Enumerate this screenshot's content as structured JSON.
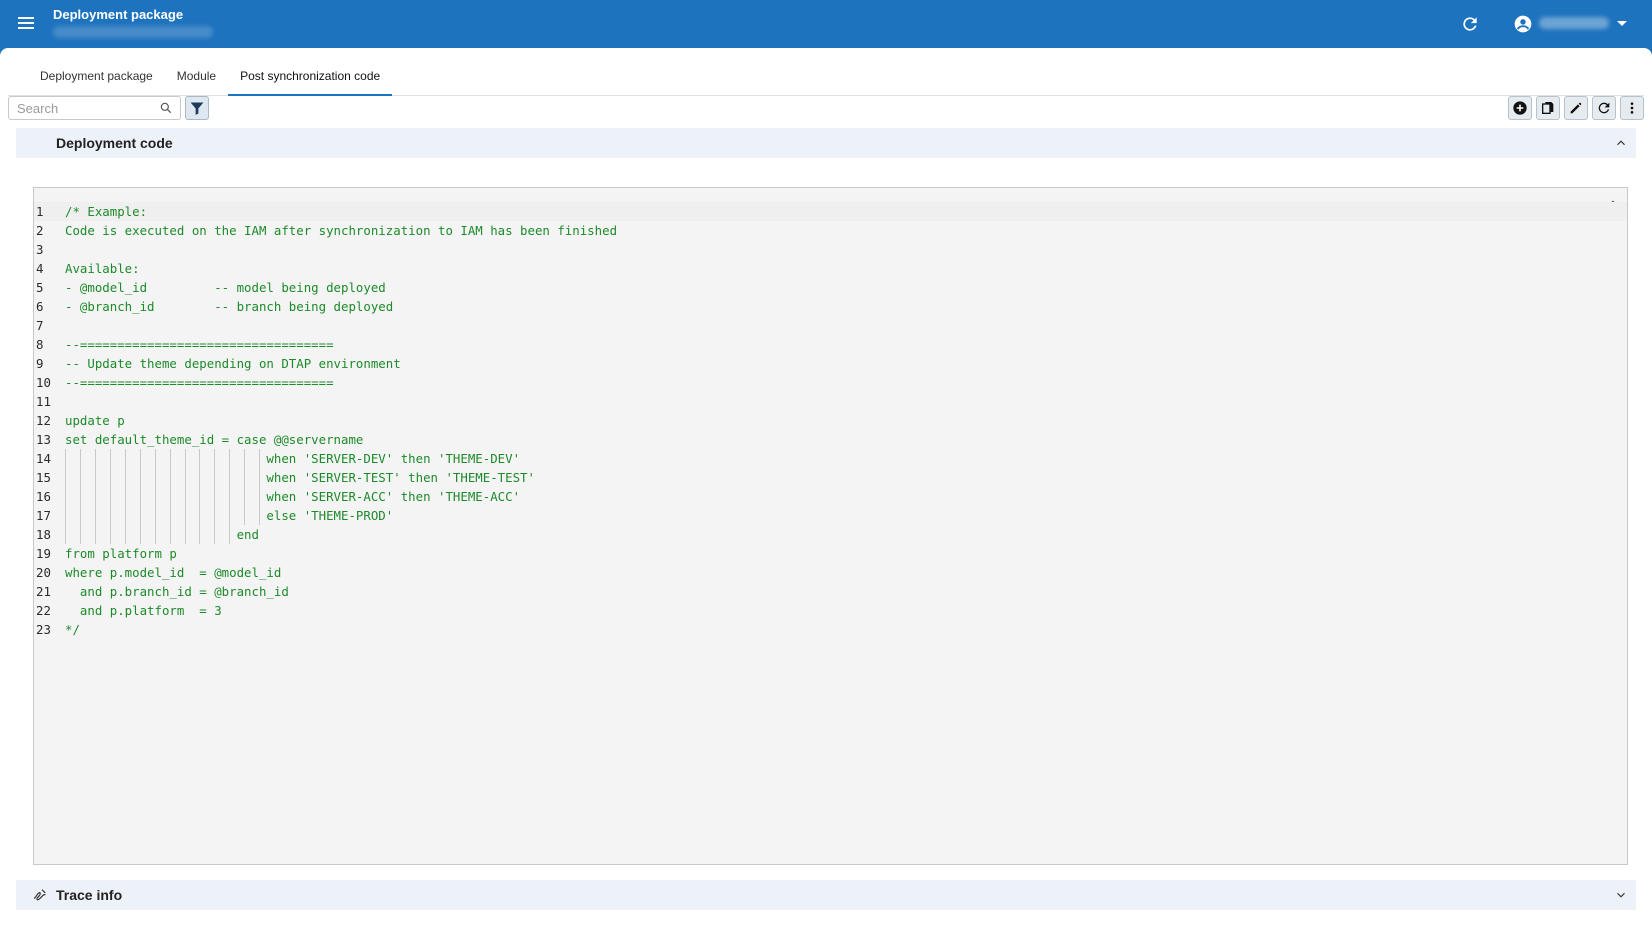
{
  "header": {
    "title": "Deployment package",
    "icons": [
      "menu-icon",
      "refresh-icon",
      "account-icon",
      "chevron-down-icon"
    ]
  },
  "tabs": [
    {
      "label": "Deployment package"
    },
    {
      "label": "Module"
    },
    {
      "label": "Post synchronization code"
    }
  ],
  "toolbar": {
    "search_placeholder": "Search",
    "right_icons": [
      "add-icon",
      "copy-icon",
      "edit-icon",
      "refresh-icon",
      "more-vert-icon"
    ]
  },
  "sections": {
    "deployment_code": {
      "title": "Deployment code"
    },
    "trace_info": {
      "title": "Trace info"
    }
  },
  "code_lines": [
    {
      "n": "1",
      "text": "/* Example:"
    },
    {
      "n": "2",
      "text": "Code is executed on the IAM after synchronization to IAM has been finished"
    },
    {
      "n": "3",
      "text": ""
    },
    {
      "n": "4",
      "text": "Available:"
    },
    {
      "n": "5",
      "text": "- @model_id         -- model being deployed"
    },
    {
      "n": "6",
      "text": "- @branch_id        -- branch being deployed"
    },
    {
      "n": "7",
      "text": ""
    },
    {
      "n": "8",
      "text": "--=================================="
    },
    {
      "n": "9",
      "text": "-- Update theme depending on DTAP environment"
    },
    {
      "n": "10",
      "text": "--=================================="
    },
    {
      "n": "11",
      "text": ""
    },
    {
      "n": "12",
      "text": "update p"
    },
    {
      "n": "13",
      "text": "set default_theme_id = case @@servername"
    },
    {
      "n": "14",
      "text": "                           when 'SERVER-DEV' then 'THEME-DEV'"
    },
    {
      "n": "15",
      "text": "                           when 'SERVER-TEST' then 'THEME-TEST'"
    },
    {
      "n": "16",
      "text": "                           when 'SERVER-ACC' then 'THEME-ACC'"
    },
    {
      "n": "17",
      "text": "                           else 'THEME-PROD'"
    },
    {
      "n": "18",
      "text": "                       end"
    },
    {
      "n": "19",
      "text": "from platform p"
    },
    {
      "n": "20",
      "text": "where p.model_id  = @model_id"
    },
    {
      "n": "21",
      "text": "  and p.branch_id = @branch_id"
    },
    {
      "n": "22",
      "text": "  and p.platform  = 3"
    },
    {
      "n": "23",
      "text": "*/"
    }
  ],
  "colors": {
    "primary": "#1e73be",
    "code_text": "#1d8a2a",
    "section_bg": "#edf2f8"
  }
}
